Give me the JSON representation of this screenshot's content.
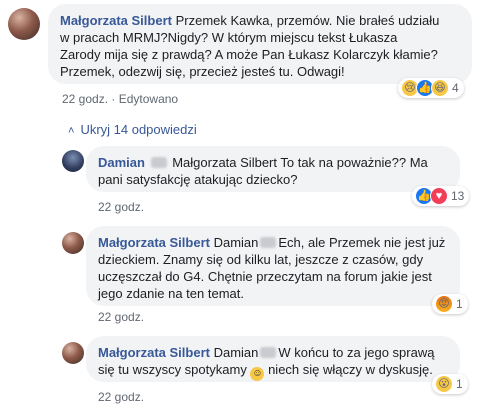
{
  "comments": [
    {
      "author": "Małgorzata Silbert",
      "text_lines": [
        "Przemek Kawka, przemów. Nie brałeś udziału",
        "w pracach MRMJ?Nigdy? W którym miejscu tekst Łukasza",
        "Zarody mija się z prawdą? A może Pan Łukasz Kolarczyk kłamie?",
        "Przemek, odezwij się, przecież jesteś tu. Odwagi!"
      ],
      "time": "22 godz.",
      "edited_separator": "·",
      "edited": "Edytowano",
      "reaction_icons": [
        "sad-icon",
        "like-icon",
        "haha-icon"
      ],
      "reaction_count": "4"
    },
    {
      "author": "Damian",
      "text_lines": [
        "Małgorzata Silbert To tak na poważnie?? Ma",
        "pani satysfakcję atakując dziecko?"
      ],
      "time": "22 godz.",
      "reaction_icons": [
        "like-icon",
        "love-icon"
      ],
      "reaction_count": "13"
    },
    {
      "author": "Małgorzata Silbert",
      "mention": "Damian",
      "text_lines": [
        "Ech, ale Przemek nie jest już",
        "dzieckiem. Znamy się od kilku lat, jeszcze z czasów, gdy",
        "uczęszczał do G4. Chętnie przeczytam na forum jakie jest",
        "jego zdanie na ten temat."
      ],
      "time": "22 godz.",
      "reaction_icons": [
        "angry-icon"
      ],
      "reaction_count": "1"
    },
    {
      "author": "Małgorzata Silbert",
      "mention": "Damian",
      "text_lines": [
        "W końcu to za jego sprawą",
        "się tu wszyscy spotykamy",
        "niech się włączy w dyskusję."
      ],
      "time": "22 godz.",
      "reaction_icons": [
        "wow-icon"
      ],
      "reaction_count": "1"
    }
  ],
  "collapse_replies": "Ukryj 14 odpowiedzi",
  "colors": {
    "author": "#385898",
    "bubble": "#f2f3f5",
    "meta": "#606770"
  }
}
